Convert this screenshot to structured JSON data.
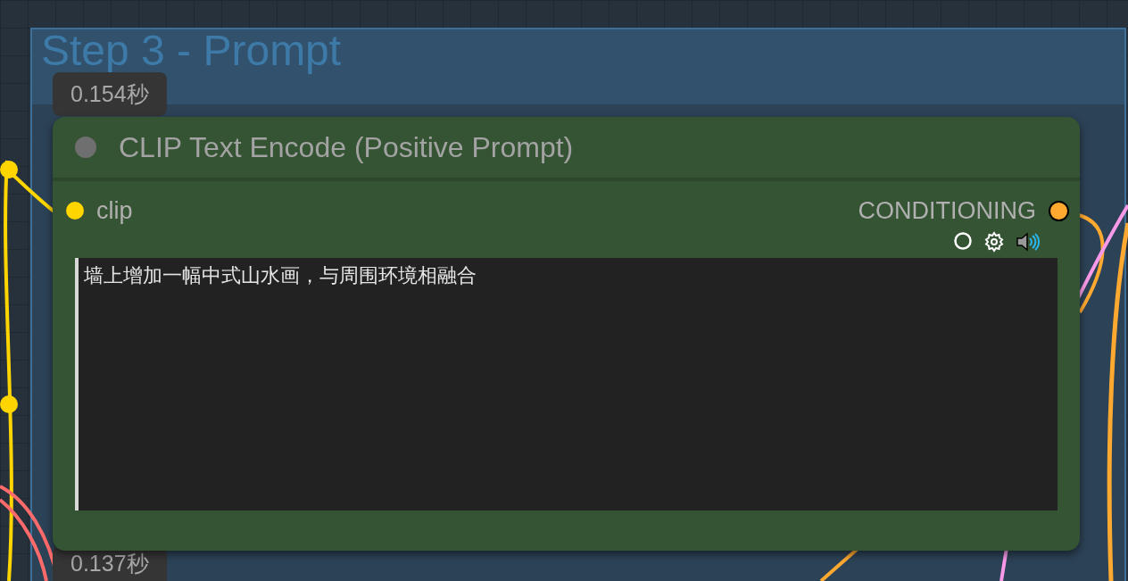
{
  "group": {
    "title": "Step 3 - Prompt"
  },
  "badges": [
    {
      "text": "0.154秒"
    },
    {
      "text": "0.137秒"
    }
  ],
  "node": {
    "title": "CLIP Text Encode (Positive Prompt)",
    "inputs": [
      {
        "name": "clip",
        "color": "#ffd500"
      }
    ],
    "outputs": [
      {
        "name": "CONDITIONING",
        "color": "#ffa931"
      }
    ],
    "prompt": "墙上增加一幅中式山水画，与周围环境相融合"
  }
}
